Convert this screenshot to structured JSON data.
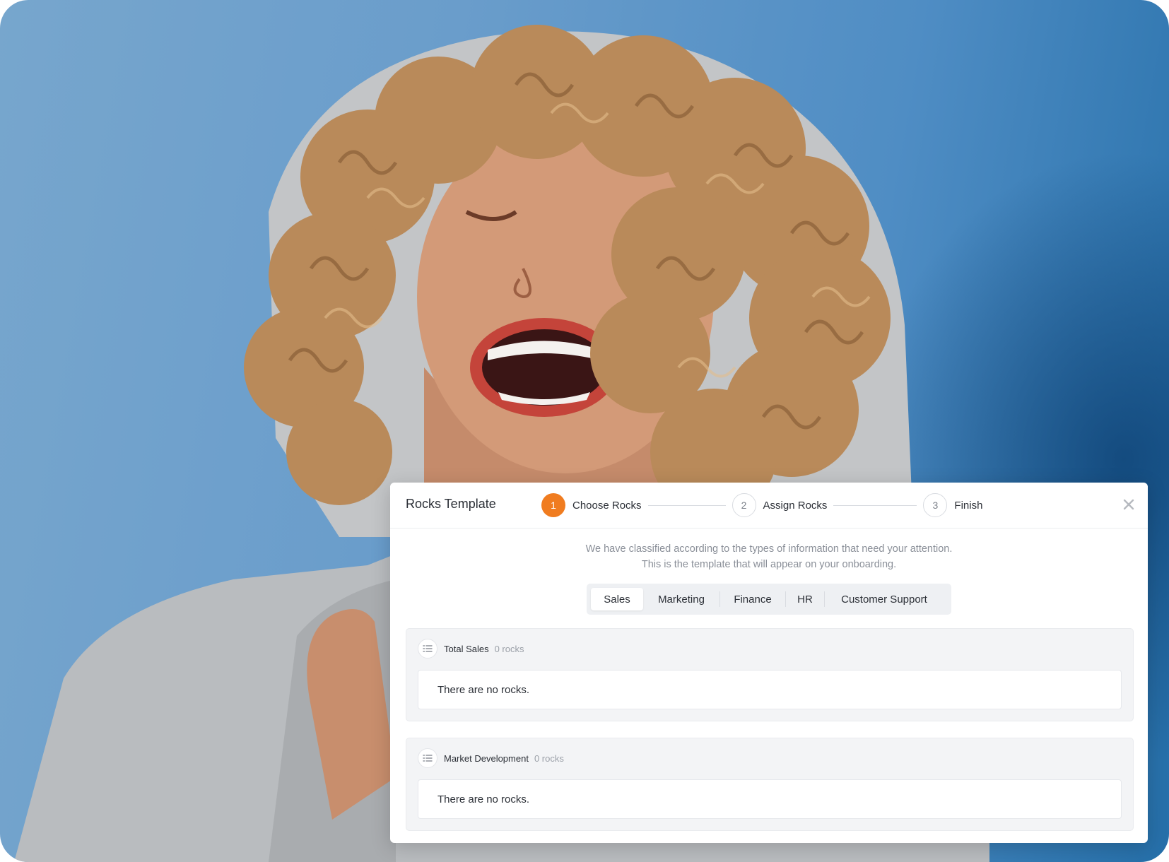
{
  "modal": {
    "title": "Rocks Template",
    "steps": [
      {
        "number": "1",
        "label": "Choose Rocks",
        "state": "active"
      },
      {
        "number": "2",
        "label": "Assign Rocks",
        "state": "pending"
      },
      {
        "number": "3",
        "label": "Finish",
        "state": "pending"
      }
    ],
    "close_icon": "close-icon",
    "subtitle_line1": "We have classified according to the types of information that need your attention.",
    "subtitle_line2": "This is the template that will appear on your onboarding.",
    "tabs": [
      "Sales",
      "Marketing",
      "Finance",
      "HR",
      "Customer Support"
    ],
    "active_tab": "Sales",
    "sections": [
      {
        "title": "Total Sales",
        "count": "0 rocks",
        "empty_text": "There are no rocks.",
        "icon": "list-icon"
      },
      {
        "title": "Market Development",
        "count": "0 rocks",
        "empty_text": "There are no rocks.",
        "icon": "list-icon"
      }
    ]
  },
  "colors": {
    "accent": "#f07c20",
    "background_blue": "#5a97c9"
  }
}
